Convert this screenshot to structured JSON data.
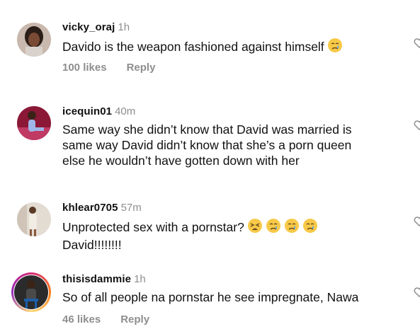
{
  "comments": [
    {
      "username": "vicky_oraj",
      "time": "1h",
      "text": "Davido is the weapon fashioned against himself",
      "emojis": [
        "crying-face"
      ],
      "likes": "100 likes",
      "reply": "Reply"
    },
    {
      "username": "icequin01",
      "time": "40m",
      "text_lines": [
        "Same way she didn’t know that David was married is",
        "same way David didn’t know that she’s a porn queen",
        "else he wouldn’t have gotten down with her"
      ]
    },
    {
      "username": "khlear0705",
      "time": "57m",
      "text_lines": [
        "Unprotected sex with a pornstar?",
        "David!!!!!!!!"
      ],
      "emojis": [
        "weary-face",
        "crying-face",
        "crying-face",
        "crying-face"
      ]
    },
    {
      "username": "thisisdammie",
      "time": "1h",
      "text": "So of all people na pornstar he see impregnate, Nawa",
      "likes": "46 likes",
      "reply": "Reply"
    }
  ],
  "icons": {
    "like": "heart-outline-icon"
  },
  "colors": {
    "secondary_text": "#8e8e8e",
    "primary_text": "#111111"
  }
}
